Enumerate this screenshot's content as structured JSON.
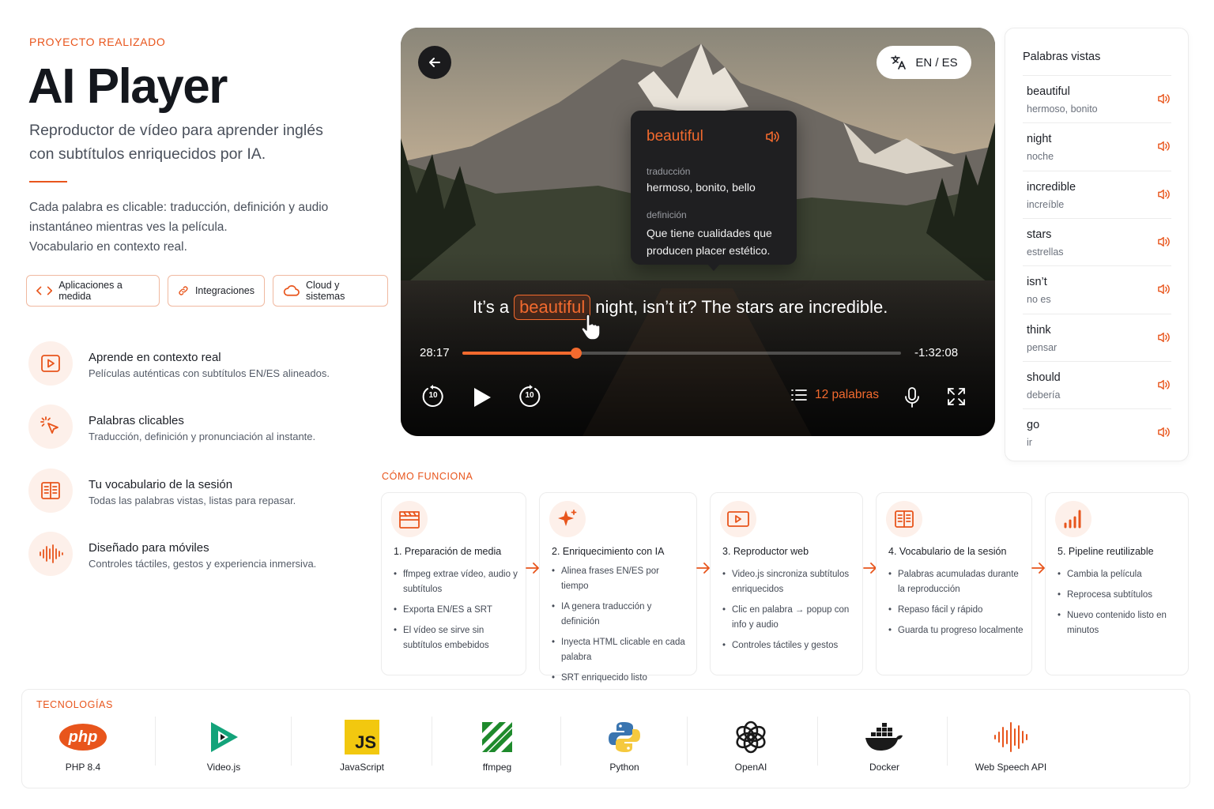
{
  "header": {
    "eyebrow": "PROYECTO REALIZADO",
    "title": "AI Player",
    "subtitle_line1": "Reproductor de vídeo para aprender inglés",
    "subtitle_line2": "con subtítulos enriquecidos por IA.",
    "desc_line1": "Cada palabra es clicable: traducción, definición y audio",
    "desc_line2": "instantáneo mientras ves la película.",
    "desc_line3": "Vocabulario en contexto real."
  },
  "tags": [
    "Aplicaciones a medida",
    "Integraciones",
    "Cloud y sistemas"
  ],
  "features": [
    {
      "title": "Aprende en contexto real",
      "text": "Películas auténticas con subtítulos EN/ES alineados.",
      "icon": "play-icon"
    },
    {
      "title": "Palabras clicables",
      "text": "Traducción, definición y pronunciación al instante.",
      "icon": "cursor-click-icon"
    },
    {
      "title": "Tu vocabulario de la sesión",
      "text": "Todas las palabras vistas, listas para repasar.",
      "icon": "book-icon"
    },
    {
      "title": "Diseñado para móviles",
      "text": "Controles táctiles, gestos y experiencia inmersiva.",
      "icon": "soundwave-icon"
    }
  ],
  "player": {
    "lang_label": "EN / ES",
    "popup": {
      "word": "beautiful",
      "translation_label": "traducción",
      "translation": "hermoso, bonito, bello",
      "definition_label": "definición",
      "definition_line1": "Que tiene cualidades que",
      "definition_line2": "producen placer estético."
    },
    "subtitle_before": "It’s a",
    "subtitle_word": "beautiful",
    "subtitle_after": "night, isn’t it? The stars are incredible.",
    "time_elapsed": "28:17",
    "time_remaining": "-1:32:08",
    "progress_fraction": 0.26,
    "skip_back": "10",
    "skip_forward": "10",
    "words_count_label": "12 palabras"
  },
  "word_list": {
    "title": "Palabras vistas",
    "items": [
      {
        "word": "beautiful",
        "translation": "hermoso, bonito"
      },
      {
        "word": "night",
        "translation": "noche"
      },
      {
        "word": "incredible",
        "translation": "increíble"
      },
      {
        "word": "stars",
        "translation": "estrellas"
      },
      {
        "word": "isn’t",
        "translation": "no es"
      },
      {
        "word": "think",
        "translation": "pensar"
      },
      {
        "word": "should",
        "translation": "debería"
      },
      {
        "word": "go",
        "translation": "ir"
      }
    ]
  },
  "how": {
    "eyebrow": "CÓMO FUNCIONA",
    "steps": [
      {
        "title": "1. Preparación de media",
        "bullets": [
          "ffmpeg extrae vídeo, audio y subtítulos",
          "Exporta EN/ES a SRT",
          "El vídeo se sirve sin subtítulos embebidos"
        ]
      },
      {
        "title": "2. Enriquecimiento con IA",
        "bullets": [
          "Alinea frases EN/ES por tiempo",
          "IA genera traducción y definición",
          "Inyecta HTML clicable en cada palabra",
          "SRT enriquecido listo"
        ]
      },
      {
        "title": "3. Reproductor web",
        "bullets": [
          "Video.js sincroniza subtítulos enriquecidos",
          "Clic en palabra → popup con info y audio",
          "Controles táctiles y gestos"
        ]
      },
      {
        "title": "4. Vocabulario de la sesión",
        "bullets": [
          "Palabras acumuladas durante la reproducción",
          "Repaso fácil y rápido",
          "Guarda tu progreso localmente"
        ]
      },
      {
        "title": "5. Pipeline reutilizable",
        "bullets": [
          "Cambia la película",
          "Reprocesa subtítulos",
          "Nuevo contenido listo en minutos"
        ]
      }
    ]
  },
  "tech": {
    "eyebrow": "TECNOLOGÍAS",
    "php_logo_text": "php",
    "js_logo_text": "JS",
    "items": [
      "PHP 8.4",
      "Video.js",
      "JavaScript",
      "ffmpeg",
      "Python",
      "OpenAI",
      "Docker",
      "Web Speech API"
    ]
  },
  "colors": {
    "accent": "#e8551c",
    "dark": "#1c1f26"
  }
}
